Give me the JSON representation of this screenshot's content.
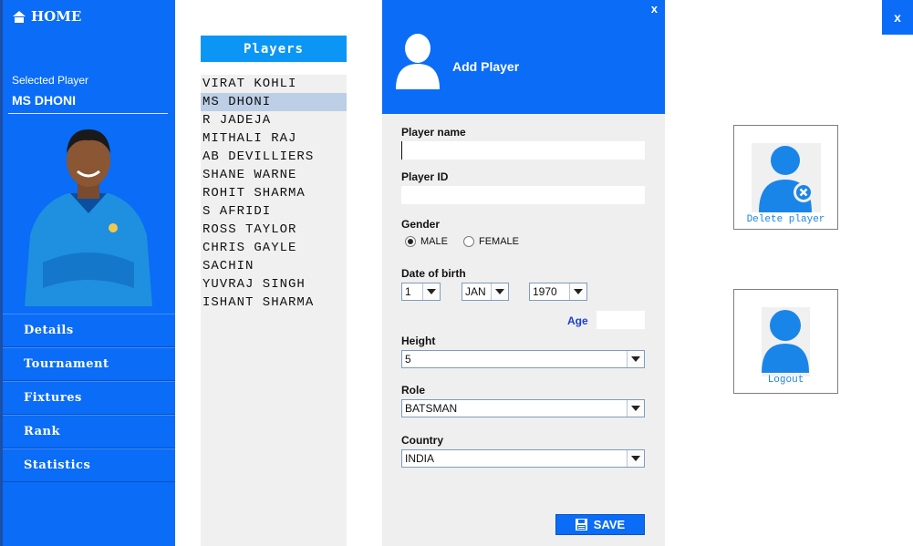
{
  "sidebar": {
    "home_label": "HOME",
    "selected_label": "Selected Player",
    "selected_name": "MS DHONI",
    "menu": [
      "Details",
      "Tournament",
      "Fixtures",
      "Rank",
      "Statistics"
    ]
  },
  "players": {
    "header": "Players",
    "selected_index": 1,
    "items": [
      "VIRAT KOHLI",
      "MS DHONI",
      "R JADEJA",
      "MITHALI RAJ",
      "AB DEVILLIERS",
      "SHANE WARNE",
      "ROHIT SHARMA",
      "S AFRIDI",
      "ROSS TAYLOR",
      "CHRIS GAYLE",
      "SACHIN",
      "YUVRAJ SINGH",
      "ISHANT SHARMA"
    ]
  },
  "dialog": {
    "close": "x",
    "title": "Add Player",
    "player_name_label": "Player name",
    "player_name_value": "",
    "player_id_label": "Player ID",
    "player_id_value": "",
    "gender_label": "Gender",
    "gender_options": [
      "MALE",
      "FEMALE"
    ],
    "gender_selected": "MALE",
    "dob_label": "Date of birth",
    "dob_day": "1",
    "dob_month": "JAN",
    "dob_year": "1970",
    "age_label": "Age",
    "age_value": "",
    "height_label": "Height",
    "height_value": "5",
    "role_label": "Role",
    "role_value": "BATSMAN",
    "country_label": "Country",
    "country_value": "INDIA",
    "save_label": "SAVE"
  },
  "right": {
    "close": "x",
    "delete_label": "Delete player",
    "logout_label": "Logout"
  },
  "colors": {
    "primary": "#0a6cf7",
    "header_blue": "#0b96f5",
    "selected_row": "#bccfe6",
    "link": "#1a85e8",
    "jersey": "#1f8fe0"
  }
}
